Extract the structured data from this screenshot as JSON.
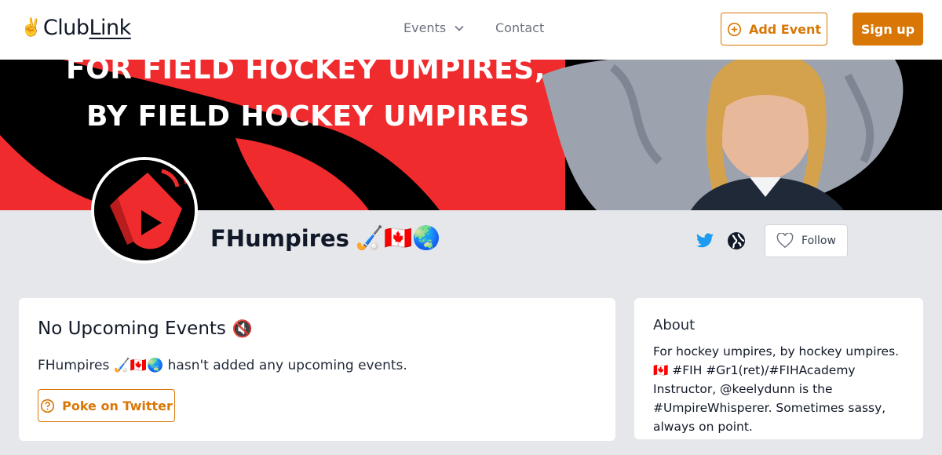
{
  "header": {
    "logo_emoji": "✌️",
    "logo_club": "Club",
    "logo_link": "Link",
    "nav_events": "Events",
    "nav_contact": "Contact",
    "add_event_label": "Add Event",
    "signup_label": "Sign up",
    "accent": "#d97706"
  },
  "banner": {
    "line1": "FOR FIELD HOCKEY UMPIRES,",
    "line2": "BY FIELD HOCKEY UMPIRES",
    "colors": {
      "red": "#ef2b2d",
      "black": "#000000",
      "gray": "#9ca3af"
    }
  },
  "profile": {
    "name": "FHumpires",
    "name_emoji": "🏑🇨🇦🌏",
    "follow_label": "Follow",
    "icons": [
      "twitter-icon",
      "globe-icon",
      "heart-icon"
    ]
  },
  "events": {
    "title": "No Upcoming Events",
    "title_emoji": "🔇",
    "description": "FHumpires 🏑🇨🇦🌏 hasn't added any upcoming events.",
    "poke_label": "Poke on Twitter"
  },
  "about": {
    "title": "About",
    "text": "For hockey umpires, by hockey umpires. 🇨🇦 #FIH #Gr1(ret)/#FIHAcademy Instructor, @keelydunn is the #UmpireWhisperer. Sometimes sassy, always on point."
  }
}
